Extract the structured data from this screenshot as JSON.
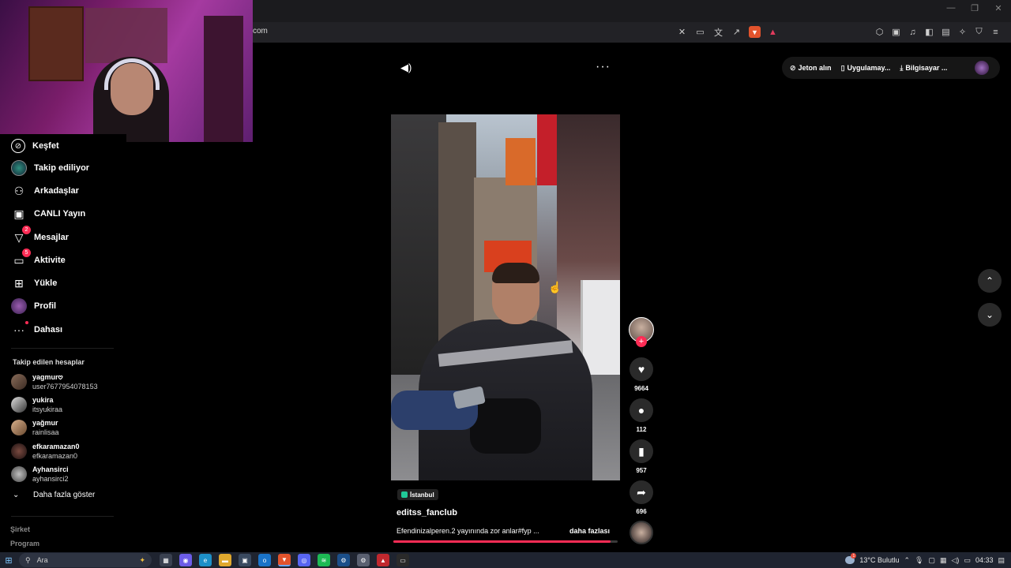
{
  "browser": {
    "url": "com",
    "window_controls": [
      "—",
      "❐",
      "✕"
    ],
    "toolbar_icons_mid": [
      "no-translate-icon",
      "cast-icon",
      "translate-icon",
      "share-icon"
    ],
    "toolbar_icons_right": [
      "extensions-icon",
      "screenshot-icon",
      "media-icon",
      "sidebar-icon",
      "wallet-icon",
      "leo-icon",
      "vpn-icon",
      "menu-icon"
    ]
  },
  "sidebar": {
    "items": [
      {
        "label": "Keşfet",
        "icon": "compass-icon"
      },
      {
        "label": "Takip ediliyor",
        "icon": "following-icon"
      },
      {
        "label": "Arkadaşlar",
        "icon": "friends-icon"
      },
      {
        "label": "CANLI Yayın",
        "icon": "live-icon"
      },
      {
        "label": "Mesajlar",
        "icon": "messages-icon",
        "badge": "2"
      },
      {
        "label": "Aktivite",
        "icon": "activity-icon",
        "badge": "5"
      },
      {
        "label": "Yükle",
        "icon": "upload-icon"
      },
      {
        "label": "Profil",
        "icon": "profile-avatar"
      },
      {
        "label": "Dahası",
        "icon": "more-icon"
      }
    ],
    "following_title": "Takip edilen hesaplar",
    "following": [
      {
        "name": "yagmur𖹭",
        "username": "user7677954078153"
      },
      {
        "name": "yukira",
        "username": "itsyukiraa"
      },
      {
        "name": "yağmur",
        "username": "rainlisaa"
      },
      {
        "name": "efkaramazan0",
        "username": "efkaramazan0"
      },
      {
        "name": "Ayhansirci",
        "username": "ayhansirci2"
      }
    ],
    "show_more": "Daha fazla göster",
    "footer": [
      "Şirket",
      "Program"
    ]
  },
  "top_right": {
    "coins": "Jeton alın",
    "app": "Uygulamay...",
    "desktop": "Bilgisayar ..."
  },
  "video": {
    "location": "İstanbul",
    "username": "editss_fanclub",
    "description": "Efendinizalperen.2 yayınında zor anlar#fyp ...",
    "more": "daha fazlası",
    "progress": 0.97,
    "likes": "9664",
    "comments": "112",
    "saves": "957",
    "shares": "696"
  },
  "taskbar": {
    "search_placeholder": "Ara",
    "weather_badge": "1",
    "weather": "13°C Bulutlu",
    "time": "04:33",
    "apps": [
      {
        "name": "task-view-icon",
        "color": "#3a4150",
        "glyph": "▦"
      },
      {
        "name": "copilot-icon",
        "color": "#6c5ce7",
        "glyph": "◉"
      },
      {
        "name": "edge-icon",
        "color": "#1e90c8",
        "glyph": "e"
      },
      {
        "name": "file-explorer-icon",
        "color": "#e0a82e",
        "glyph": "▬"
      },
      {
        "name": "store-icon",
        "color": "#3a4a60",
        "glyph": "▣"
      },
      {
        "name": "outlook-icon",
        "color": "#1a73c8",
        "glyph": "o"
      },
      {
        "name": "brave-icon",
        "color": "#e2532c",
        "glyph": "▼",
        "active": true
      },
      {
        "name": "discord-icon",
        "color": "#5865f2",
        "glyph": "◎"
      },
      {
        "name": "spotify-icon",
        "color": "#1db954",
        "glyph": "≋"
      },
      {
        "name": "steam-icon",
        "color": "#1b4f8a",
        "glyph": "⚙"
      },
      {
        "name": "settings-icon",
        "color": "#5a6070",
        "glyph": "⚙"
      },
      {
        "name": "msi-icon",
        "color": "#c0282e",
        "glyph": "▲"
      },
      {
        "name": "terminal-icon",
        "color": "#2a2a2a",
        "glyph": "▭"
      }
    ]
  }
}
